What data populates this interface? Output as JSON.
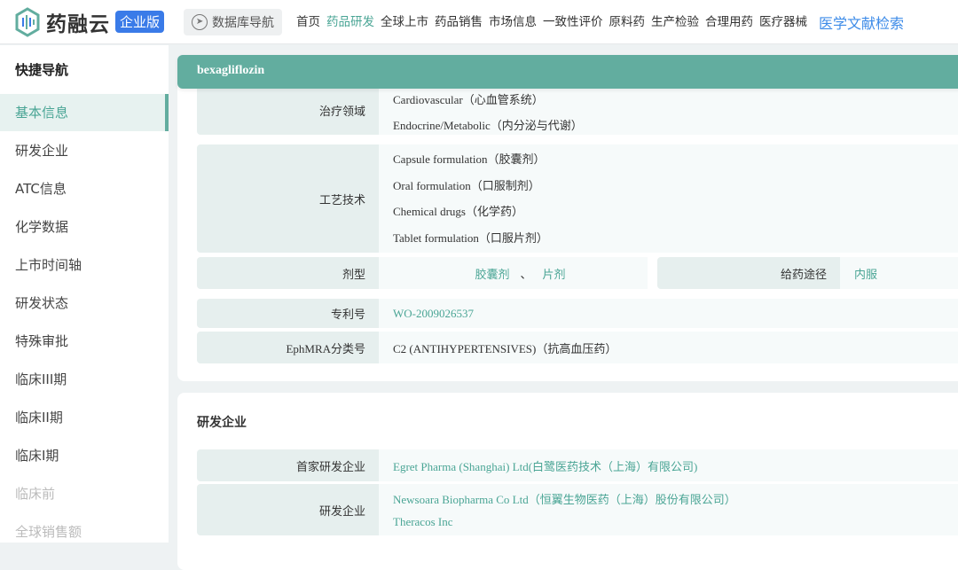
{
  "header": {
    "logo": "药融云",
    "badge": "企业版",
    "db_nav": "数据库导航",
    "nav": [
      "首页",
      "药品研发",
      "全球上市",
      "药品销售",
      "市场信息",
      "一致性评价",
      "原料药",
      "生产检验",
      "合理用药",
      "医疗器械"
    ],
    "nav_active": 1,
    "literature": "医学文献检索"
  },
  "sidebar": {
    "title": "快捷导航",
    "items": [
      "基本信息",
      "研发企业",
      "ATC信息",
      "化学数据",
      "上市时间轴",
      "研发状态",
      "特殊审批",
      "临床III期",
      "临床II期",
      "临床I期",
      "临床前",
      "全球销售额"
    ]
  },
  "drug": {
    "name": "bexagliflozin",
    "therapy_label": "治疗领域",
    "therapy": [
      "Cardiovascular（心血管系统）",
      "Endocrine/Metabolic（内分泌与代谢）"
    ],
    "tech_label": "工艺技术",
    "tech": [
      "Capsule formulation（胶囊剂）",
      "Oral formulation（口服制剂）",
      "Chemical drugs（化学药）",
      "Tablet formulation（口服片剂）"
    ],
    "form_label": "剂型",
    "forms": [
      "胶囊剂",
      "片剂"
    ],
    "form_sep": "、",
    "route_label": "给药途径",
    "route": "内服",
    "patent_label": "专利号",
    "patent": "WO-2009026537",
    "ephmra_label": "EphMRA分类号",
    "ephmra": "C2 (ANTIHYPERTENSIVES)（抗高血压药）"
  },
  "companies": {
    "title": "研发企业",
    "first_label": "首家研发企业",
    "first": "Egret Pharma (Shanghai) Ltd(白鹭医药技术（上海）有限公司)",
    "dev_label": "研发企业",
    "dev": [
      "Newsoara Biopharma Co Ltd（恒翼生物医药（上海）股份有限公司）",
      "Theracos Inc"
    ]
  },
  "colors": {
    "accent": "#62ad9f",
    "link": "#4aa595",
    "brand_blue": "#3a7be8"
  }
}
